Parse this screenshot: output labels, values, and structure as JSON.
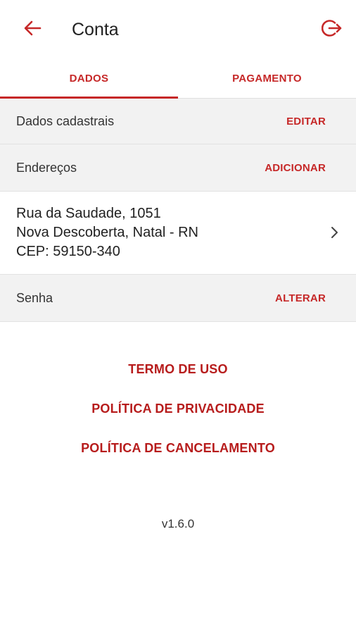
{
  "header": {
    "title": "Conta",
    "back_icon": "arrow-left-icon",
    "logout_icon": "logout-icon"
  },
  "colors": {
    "accent": "#c62828",
    "section_bg": "#f2f2f2"
  },
  "tabs": [
    {
      "label": "DADOS",
      "active": true
    },
    {
      "label": "PAGAMENTO",
      "active": false
    }
  ],
  "sections": {
    "cadastro": {
      "label": "Dados cadastrais",
      "action": "EDITAR"
    },
    "enderecos": {
      "label": "Endereços",
      "action": "ADICIONAR"
    },
    "senha": {
      "label": "Senha",
      "action": "ALTERAR"
    }
  },
  "address": {
    "line1": "Rua da Saudade, 1051",
    "line2": "Nova Descoberta, Natal - RN",
    "line3": "CEP: 59150-340"
  },
  "links": {
    "terms": "TERMO DE USO",
    "privacy": "POLÍTICA DE PRIVACIDADE",
    "cancellation": "POLÍTICA DE CANCELAMENTO"
  },
  "version": "v1.6.0"
}
